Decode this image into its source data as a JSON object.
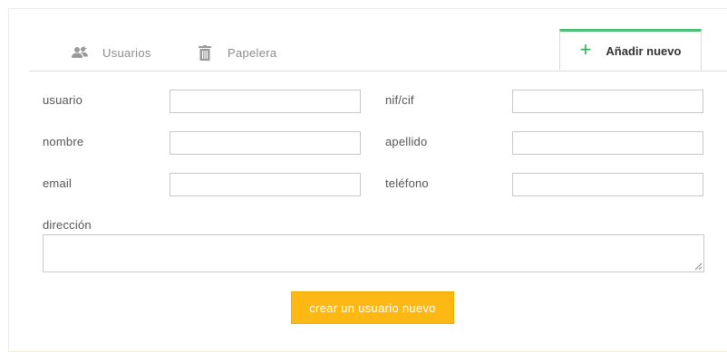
{
  "tabs": {
    "users": {
      "label": "Usuarios",
      "icon": "users-icon"
    },
    "trash": {
      "label": "Papelera",
      "icon": "trash-icon"
    },
    "add_new": {
      "label": "Añadir nuevo",
      "icon": "plus-icon",
      "icon_glyph": "+"
    }
  },
  "form": {
    "usuario": {
      "label": "usuario",
      "value": "",
      "placeholder": ""
    },
    "nif": {
      "label": "nif/cif",
      "value": "",
      "placeholder": ""
    },
    "nombre": {
      "label": "nombre",
      "value": "",
      "placeholder": ""
    },
    "apellido": {
      "label": "apellido",
      "value": "",
      "placeholder": ""
    },
    "email": {
      "label": "email",
      "value": "",
      "placeholder": ""
    },
    "telefono": {
      "label": "teléfono",
      "value": "",
      "placeholder": ""
    },
    "direccion": {
      "label": "dirección",
      "value": "",
      "placeholder": ""
    },
    "submit_label": "crear un usuario nuevo"
  },
  "colors": {
    "accent_tab": "#4cbf76",
    "plus": "#2fae5c",
    "submit_bg": "#fdb813",
    "panel_border": "#f6ead9"
  }
}
